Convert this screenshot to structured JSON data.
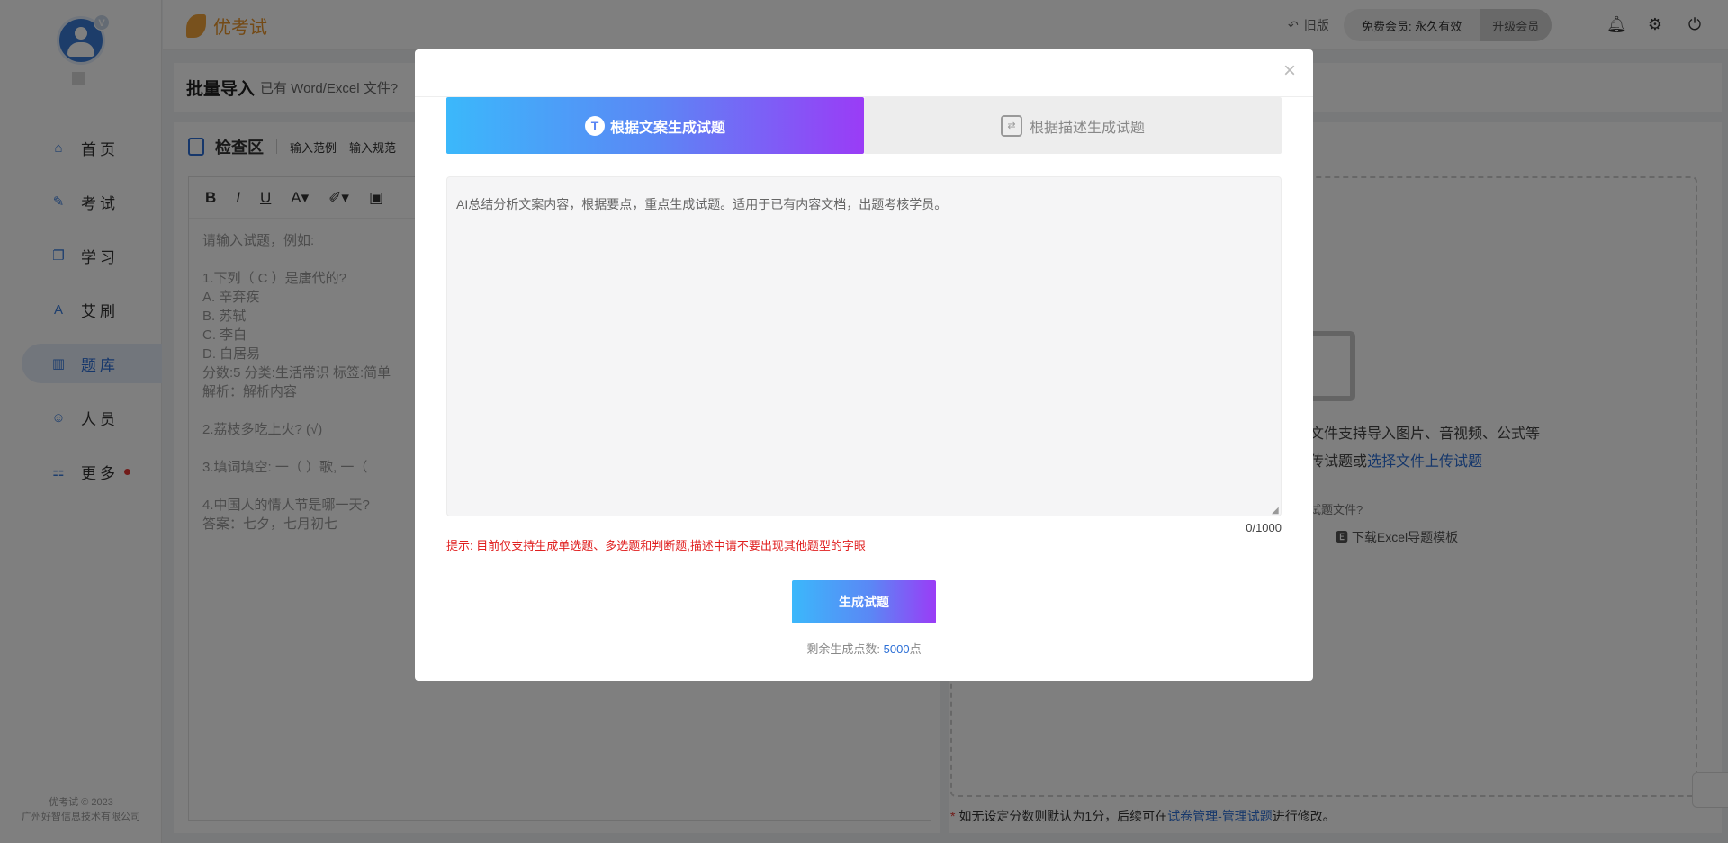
{
  "sidebar": {
    "vip_badge": "V",
    "nav": [
      {
        "label": "首页",
        "icon": "home-icon",
        "glyph": "⌂"
      },
      {
        "label": "考试",
        "icon": "pen-icon",
        "glyph": "✎"
      },
      {
        "label": "学习",
        "icon": "book-icon",
        "glyph": "❐"
      },
      {
        "label": "艾刷",
        "icon": "letter-a-icon",
        "glyph": "A"
      },
      {
        "label": "题库",
        "icon": "bar-chart-icon",
        "glyph": "▥"
      },
      {
        "label": "人员",
        "icon": "user-icon",
        "glyph": "☺"
      },
      {
        "label": "更多",
        "icon": "apps-icon",
        "glyph": "⚏"
      }
    ],
    "active_index": 4,
    "footer_line1": "优考试 © 2023",
    "footer_line2": "广州好智信息技术有限公司"
  },
  "topbar": {
    "brand": "优考试",
    "old_version": "旧版",
    "member_status": "免费会员: 永久有效",
    "upgrade": "升级会员"
  },
  "page": {
    "title": "批量导入",
    "subtitle": "已有 Word/Excel 文件?",
    "check_area": "检查区",
    "link_example": "输入范例",
    "link_rules": "输入规范",
    "editor_placeholder_lines": "请输入试题，例如:\n\n1.下列（ C ）是唐代的?\nA. 辛弃疾\nB. 苏轼\nC. 李白\nD. 白居易\n分数:5 分类:生活常识 标签:简单\n解析：解析内容\n\n2.荔枝多吃上火?  (√)\n\n3.填词填空: 一（     ）歌, 一（\n\n4.中国人的情人节是哪一天?\n答案：七夕，七月初七",
    "dropzone_line1": "文件支持导入图片、音视频、公式等",
    "dropzone_line2_prefix": "传试题或",
    "dropzone_line2_link": "选择文件上传试题",
    "dropzone_line3": "试题文件?",
    "download_template": "下载Excel导题模板",
    "note_star": "*",
    "note_text": "如无设定分数则默认为1分，后续可在",
    "note_link": "试卷管理-管理试题",
    "note_suffix": "进行修改。"
  },
  "modal": {
    "close": "×",
    "tab_active": "根据文案生成试题",
    "tab_active_icon": "T",
    "tab_inactive": "根据描述生成试题",
    "textarea_placeholder": "AI总结分析文案内容，根据要点，重点生成试题。适用于已有内容文档，出题考核学员。",
    "textarea_value": "",
    "counter": "0/1000",
    "tip": "提示: 目前仅支持生成单选题、多选题和判断题,描述中请不要出现其他题型的字眼",
    "generate_button": "生成试题",
    "remaining_prefix": "剩余生成点数: ",
    "remaining_value": "5000",
    "remaining_suffix": "点"
  },
  "colors": {
    "accent": "#2c6fd6",
    "gradient_start": "#3bb8fb",
    "gradient_end": "#9a3cf6",
    "tip_red": "#e02020"
  }
}
